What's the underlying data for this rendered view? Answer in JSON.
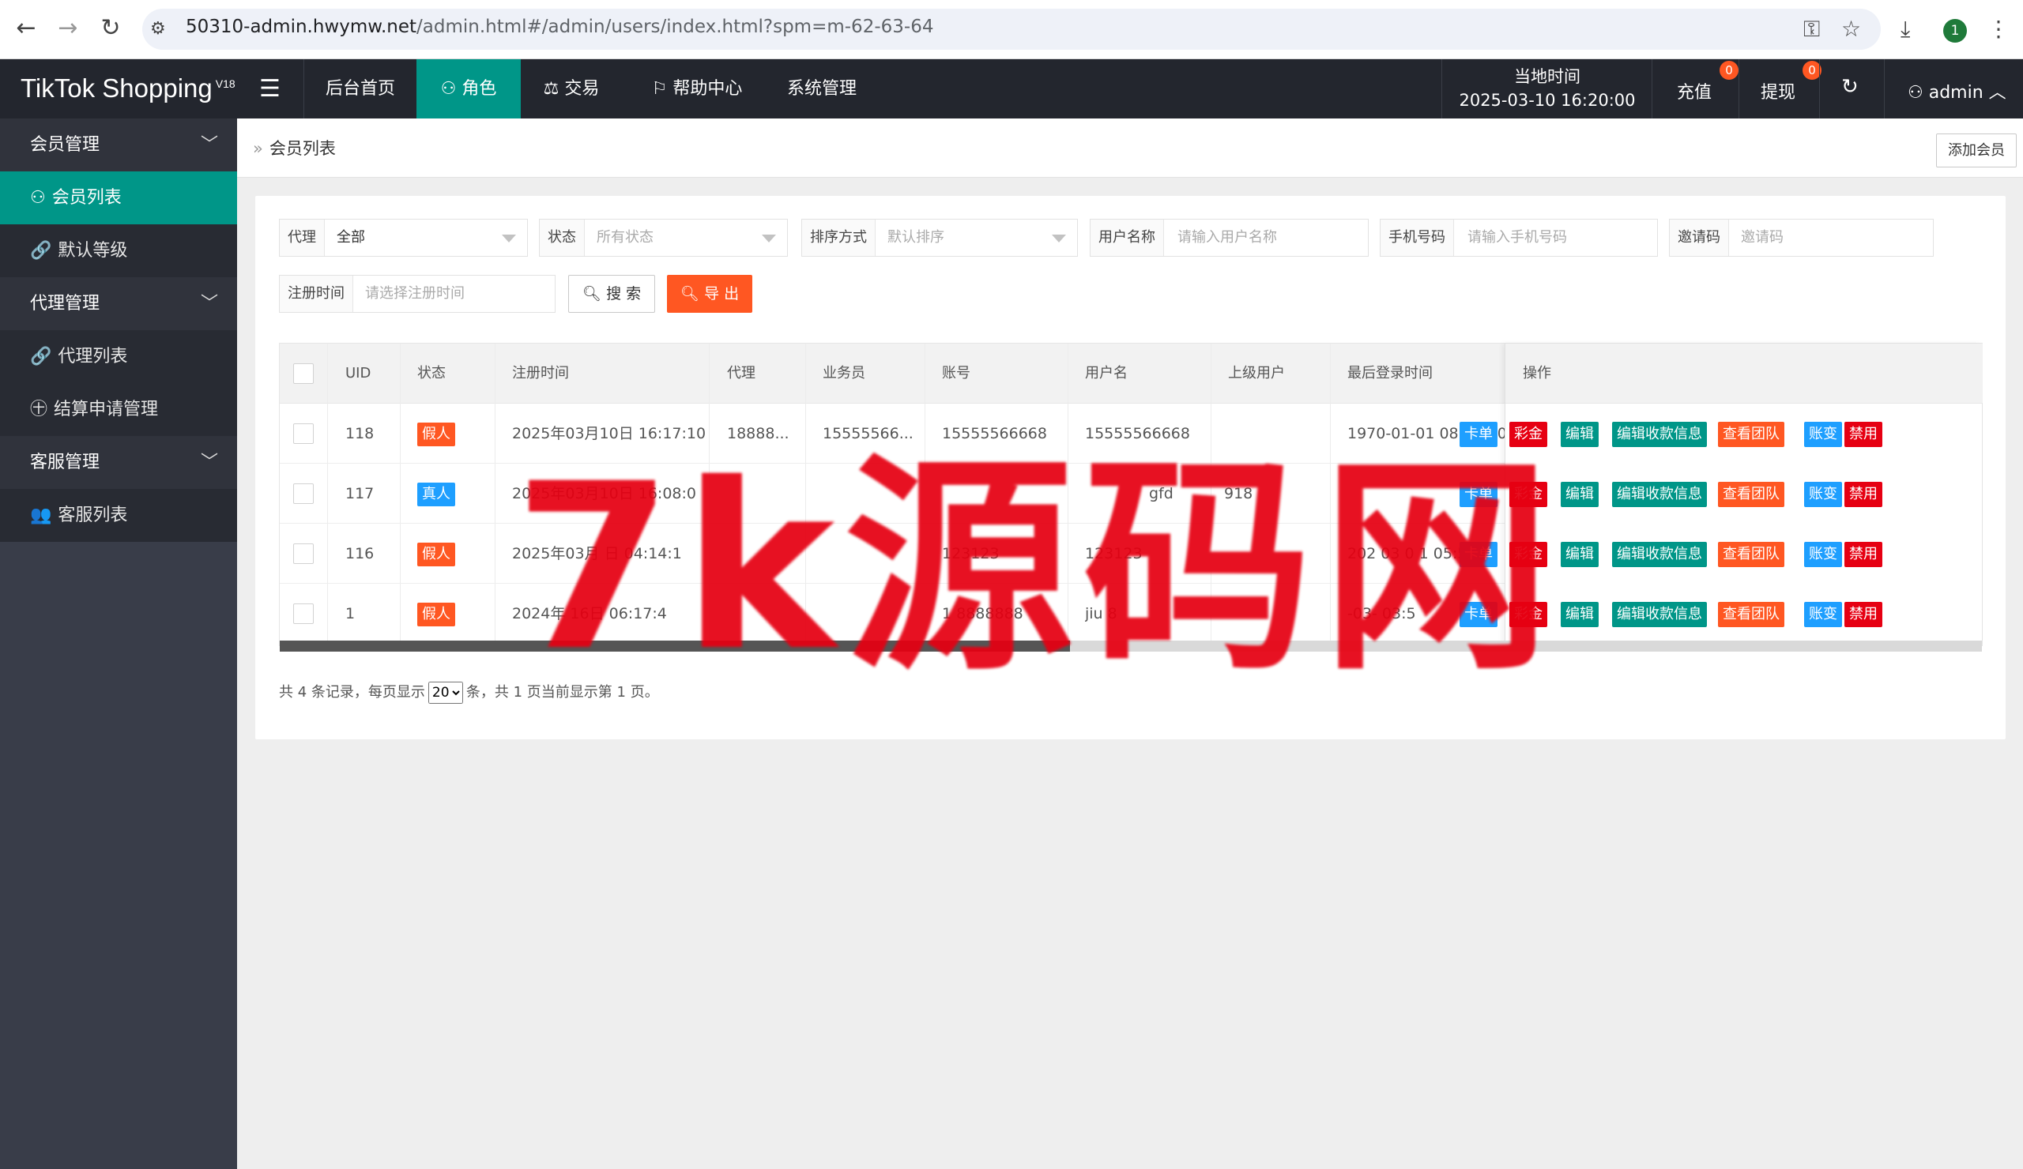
{
  "browser": {
    "url_host": "50310-admin.hwymw.net",
    "url_path": "/admin.html#/admin/users/index.html?spm=m-62-63-64",
    "profile_initial": "1"
  },
  "header": {
    "logo": "TikTok Shopping",
    "logo_version": "V18",
    "nav": [
      {
        "label": "后台首页"
      },
      {
        "label": "角色"
      },
      {
        "label": "交易"
      },
      {
        "label": "帮助中心"
      },
      {
        "label": "系统管理"
      }
    ],
    "clock_label": "当地时间",
    "clock_value": "2025-03-10 16:20:00",
    "recharge_label": "充值",
    "recharge_badge": "0",
    "withdraw_label": "提现",
    "withdraw_badge": "0",
    "user_label": "admin"
  },
  "sidebar": {
    "groups": [
      {
        "label": "会员管理",
        "items": [
          {
            "label": "会员列表"
          },
          {
            "label": "默认等级"
          }
        ]
      },
      {
        "label": "代理管理",
        "items": [
          {
            "label": "代理列表"
          },
          {
            "label": "结算申请管理"
          }
        ]
      },
      {
        "label": "客服管理",
        "items": [
          {
            "label": "客服列表"
          }
        ]
      }
    ]
  },
  "breadcrumb": {
    "current": "会员列表"
  },
  "add_button": "添加会员",
  "filters": {
    "agent": {
      "label": "代理",
      "value": "全部"
    },
    "status": {
      "label": "状态",
      "placeholder": "所有状态"
    },
    "sort": {
      "label": "排序方式",
      "placeholder": "默认排序"
    },
    "username": {
      "label": "用户名称",
      "placeholder": "请输入用户名称"
    },
    "phone": {
      "label": "手机号码",
      "placeholder": "请输入手机号码"
    },
    "invite": {
      "label": "邀请码",
      "placeholder": "邀请码"
    },
    "regtime": {
      "label": "注册时间",
      "placeholder": "请选择注册时间"
    },
    "search_button": "搜 索",
    "export_button": "导 出"
  },
  "table": {
    "headers": [
      "UID",
      "状态",
      "注册时间",
      "代理",
      "业务员",
      "账号",
      "用户名",
      "上级用户",
      "最后登录时间",
      "操作"
    ],
    "rows": [
      {
        "uid": "118",
        "status": "假人",
        "regtime": "2025年03月10日 16:17:10",
        "agent": "18888...",
        "staff": "15555566...",
        "account": "15555566668",
        "username": "15555566668",
        "parent": "",
        "last_login": "1970-01-01 08:00:00"
      },
      {
        "uid": "117",
        "status": "真人",
        "regtime": "2025年03月10日 16:08:0",
        "agent": "",
        "staff": "",
        "account": "",
        "username": "gfd",
        "parent": "918",
        "last_login": ""
      },
      {
        "uid": "116",
        "status": "假人",
        "regtime": "2025年03月 日 04:14:1",
        "agent": "",
        "staff": "",
        "account": "123123",
        "username": "123123",
        "parent": "",
        "last_login": "202 03 0 1 05:5"
      },
      {
        "uid": "1",
        "status": "假人",
        "regtime": "2024年 16日 06:17:4",
        "agent": "",
        "staff": "",
        "account": "1 8888888",
        "username": "jiu 8",
        "parent": "",
        "last_login": "-03- 03:5"
      }
    ],
    "actions": [
      "卡单",
      "彩金",
      "编辑",
      "编辑收款信息",
      "查看团队",
      "账变",
      "禁用"
    ]
  },
  "pager": {
    "prefix": "共 4 条记录，每页显示",
    "page_size": "20",
    "suffix": "条，共 1 页当前显示第 1 页。"
  },
  "watermark": "7k源码网",
  "colors": {
    "teal": "#009688",
    "orange": "#ff5722",
    "blue": "#1e9fff",
    "red": "#e60012",
    "dark": "#23262e"
  }
}
